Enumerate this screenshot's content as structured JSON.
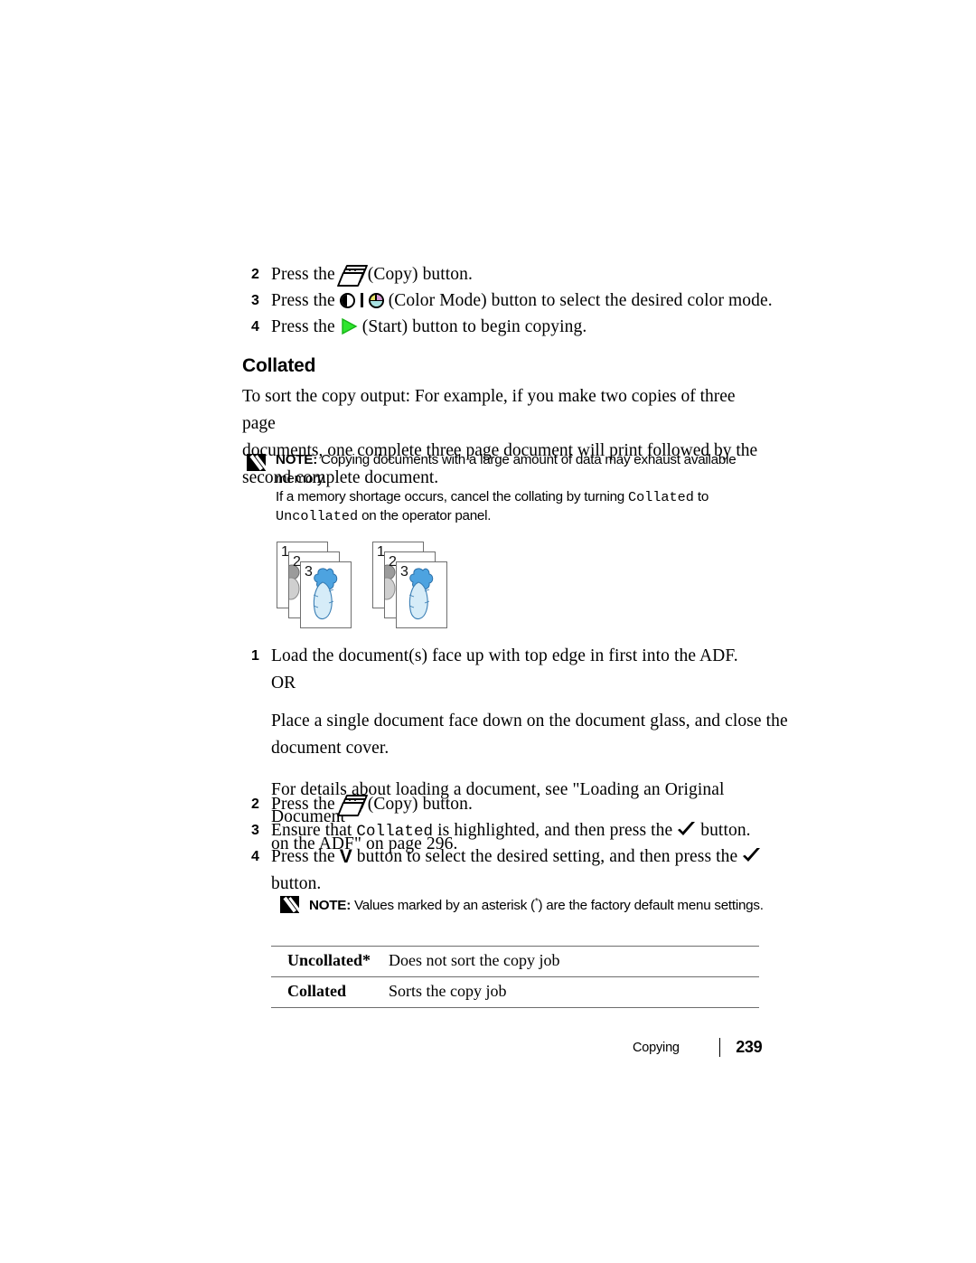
{
  "document": {
    "title": "Collated",
    "section_heading": "Collated"
  },
  "top_steps": [
    {
      "num": "2",
      "pre": "Press the",
      "icon": "copy-icon",
      "post": "(Copy) button."
    },
    {
      "num": "3",
      "pre": "Press the",
      "icon": "color-mode-icon",
      "post": "(Color Mode) button to select the desired color mode."
    },
    {
      "num": "4",
      "pre": "Press the",
      "icon": "start-icon",
      "post": "(Start) button to begin copying."
    }
  ],
  "intro_paragraph": {
    "line1": "To sort the copy output: For example, if you make two copies of three page",
    "line2": "documents, one complete three page document will print followed by the",
    "line3": "second complete document."
  },
  "note_memory": {
    "label": "NOTE:",
    "line1": "Copying documents with a large amount of data may exhaust available",
    "line2": "memory.",
    "line3_a": "If a memory shortage occurs, cancel the collating by turning ",
    "line3_mono": "Collated",
    "line3_b": " to",
    "line4_mono": "Uncollated",
    "line4_b": " on the operator panel."
  },
  "illustration": {
    "name": "collated-output-diagram",
    "stacks": [
      {
        "sheets": [
          "1",
          "2",
          "3"
        ]
      },
      {
        "sheets": [
          "1",
          "2",
          "3"
        ]
      }
    ]
  },
  "procedure_steps": [
    {
      "num": "1",
      "line1": "Load the document(s) face up with top edge in first into the ADF.",
      "line2": "OR",
      "line3": "Place a single document face down on the document glass, and close the",
      "line4": "document cover.",
      "line5": "For details about loading a document, see \"Loading an Original Document",
      "line6": "on the ADF\" on page 296."
    },
    {
      "num": "2",
      "pre": "Press the",
      "icon": "copy-icon",
      "post": "(Copy) button."
    },
    {
      "num": "3",
      "pre": "Ensure that ",
      "mono": "Collated",
      "mid": " is highlighted, and then press the",
      "icon": "check-icon",
      "post": "button."
    },
    {
      "num": "4",
      "pre": "Press the",
      "icon": "down-arrow-icon",
      "arrow_glyph": "V",
      "mid": "button to select the desired setting, and then press the",
      "icon2": "check-icon",
      "post": "button."
    }
  ],
  "note_asterisk": {
    "label": "NOTE:",
    "text_a": "Values marked by an asterisk (",
    "asterisk": "*",
    "text_b": ") are the factory default menu settings."
  },
  "settings_table": {
    "rows": [
      {
        "name": "Uncollated*",
        "description": "Does not sort the copy job"
      },
      {
        "name": "Collated",
        "description": "Sorts the copy job"
      }
    ]
  },
  "footer": {
    "section": "Copying",
    "page_number": "239"
  },
  "colors": {
    "start_green": "#2ee52e",
    "carrot_body": "#d6ecf8",
    "carrot_leaf": "#4da3e0",
    "rule_gray": "#6d6d6d"
  }
}
